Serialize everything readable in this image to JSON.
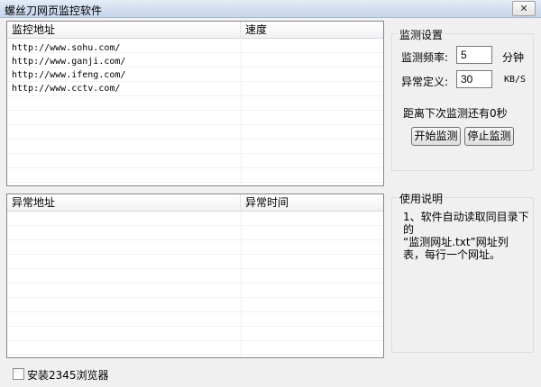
{
  "window": {
    "title": "螺丝刀网页监控软件",
    "close_glyph": "✕"
  },
  "monitor_list": {
    "columns": [
      "监控地址",
      "速度"
    ],
    "rows": [
      {
        "url": "http://www.sohu.com/",
        "speed": ""
      },
      {
        "url": "http://www.ganji.com/",
        "speed": ""
      },
      {
        "url": "http://www.ifeng.com/",
        "speed": ""
      },
      {
        "url": "http://www.cctv.com/",
        "speed": ""
      }
    ]
  },
  "anomaly_list": {
    "columns": [
      "异常地址",
      "异常时间"
    ],
    "rows": []
  },
  "settings": {
    "legend": "监测设置",
    "frequency_label": "监测频率:",
    "frequency_value": "5",
    "frequency_unit": "分钟",
    "anomaly_label": "异常定义:",
    "anomaly_value": "30",
    "anomaly_unit": "KB/S",
    "countdown_text": "距离下次监测还有0秒",
    "start_button": "开始监测",
    "stop_button": "停止监测"
  },
  "help": {
    "legend": "使用说明",
    "text": "1、软件自动读取同目录下的\n“监测网址.txt”网址列\n表，每行一个网址。"
  },
  "footer": {
    "checkbox_label": "安装2345浏览器",
    "checkbox_checked": false
  }
}
